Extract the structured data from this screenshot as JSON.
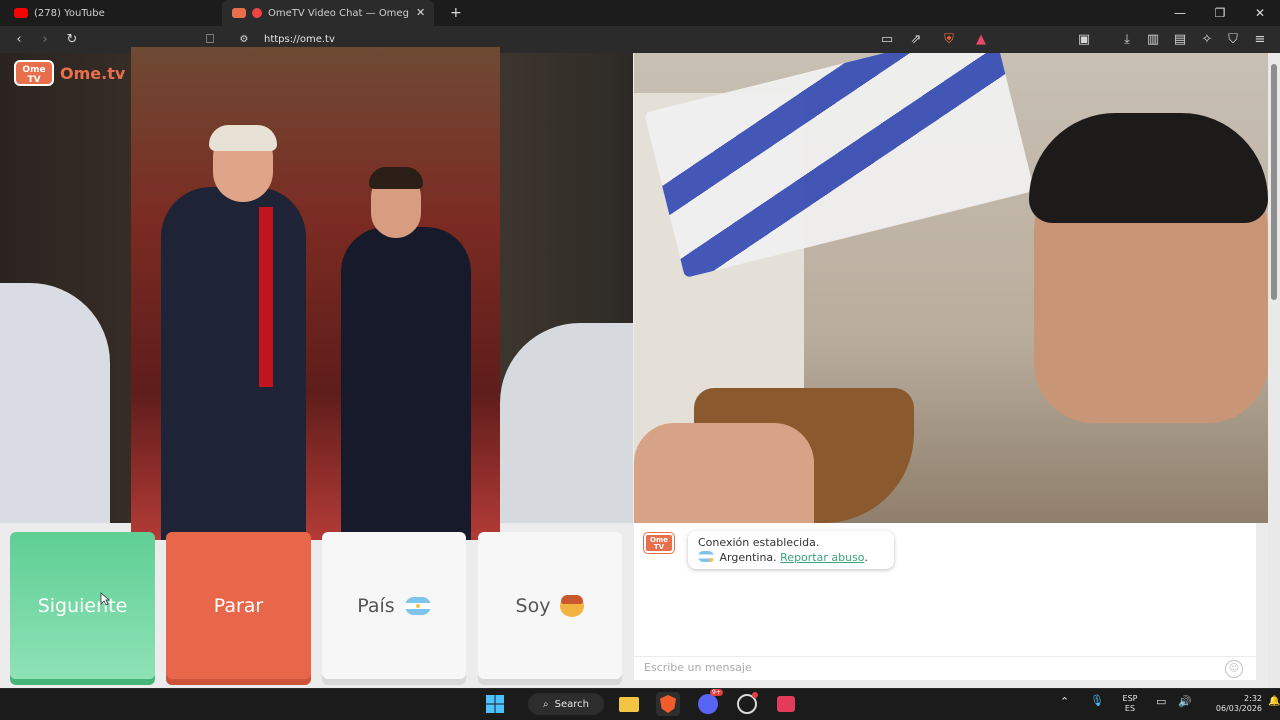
{
  "browser": {
    "tabs": [
      {
        "title": "(278) YouTube",
        "active": false,
        "icon": "youtube-icon"
      },
      {
        "title": "OmeTV Video Chat — Omeg",
        "active": true,
        "icon": "ometv-icon"
      }
    ],
    "url": "https://ome.tv"
  },
  "site": {
    "logo_badge": "Ome TV",
    "logo_text": "Ome.tv"
  },
  "buttons": {
    "next": "Siguiente",
    "stop": "Parar",
    "country": "País",
    "me": "Soy"
  },
  "chat": {
    "logo_badge": "Ome TV",
    "status": "Conexión establecida.",
    "country": "Argentina.",
    "report_link": "Reportar abuso",
    "report_suffix": ".",
    "placeholder": "Escribe un mensaje"
  },
  "taskbar": {
    "search_label": "Search",
    "lang_top": "ESP",
    "lang_bottom": "ES",
    "time": "2:32",
    "date": "06/03/2026",
    "discord_badge": "9+"
  },
  "colors": {
    "accent_green": "#5fcf95",
    "accent_orange": "#e8674b",
    "brand": "#e86f4c",
    "link": "#3aa37a"
  }
}
